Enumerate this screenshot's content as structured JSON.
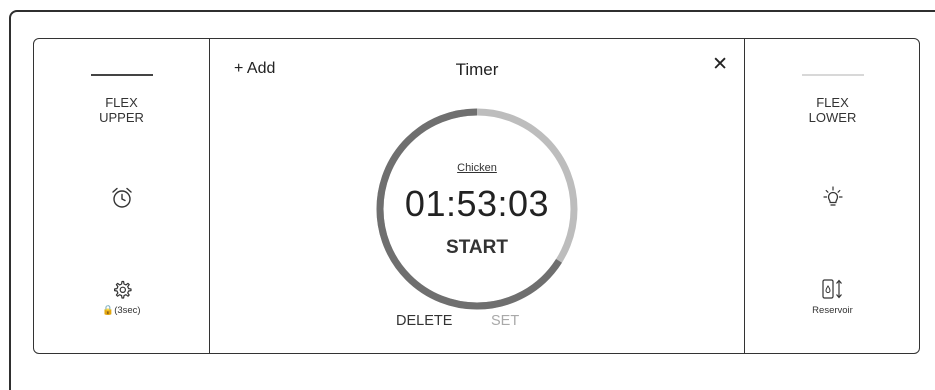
{
  "left_panel": {
    "zone_line1": "FLEX",
    "zone_line2": "UPPER",
    "alarm_icon": "alarm-clock-icon",
    "settings_icon": "gear-icon",
    "lock_caption": "🔒(3sec)"
  },
  "timer": {
    "add_label": "+ Add",
    "title": "Timer",
    "close_label": "✕",
    "name": "Chicken",
    "time": "01:53:03",
    "start_label": "START",
    "delete_label": "DELETE",
    "set_label": "SET",
    "progress_fraction": 0.66,
    "ring_color": "#6f6f6f",
    "ring_track_color": "#bdbdbd"
  },
  "right_panel": {
    "zone_line1": "FLEX",
    "zone_line2": "LOWER",
    "light_icon": "light-bulb-icon",
    "reservoir_icon": "water-reservoir-icon",
    "reservoir_caption": "Reservoir"
  }
}
